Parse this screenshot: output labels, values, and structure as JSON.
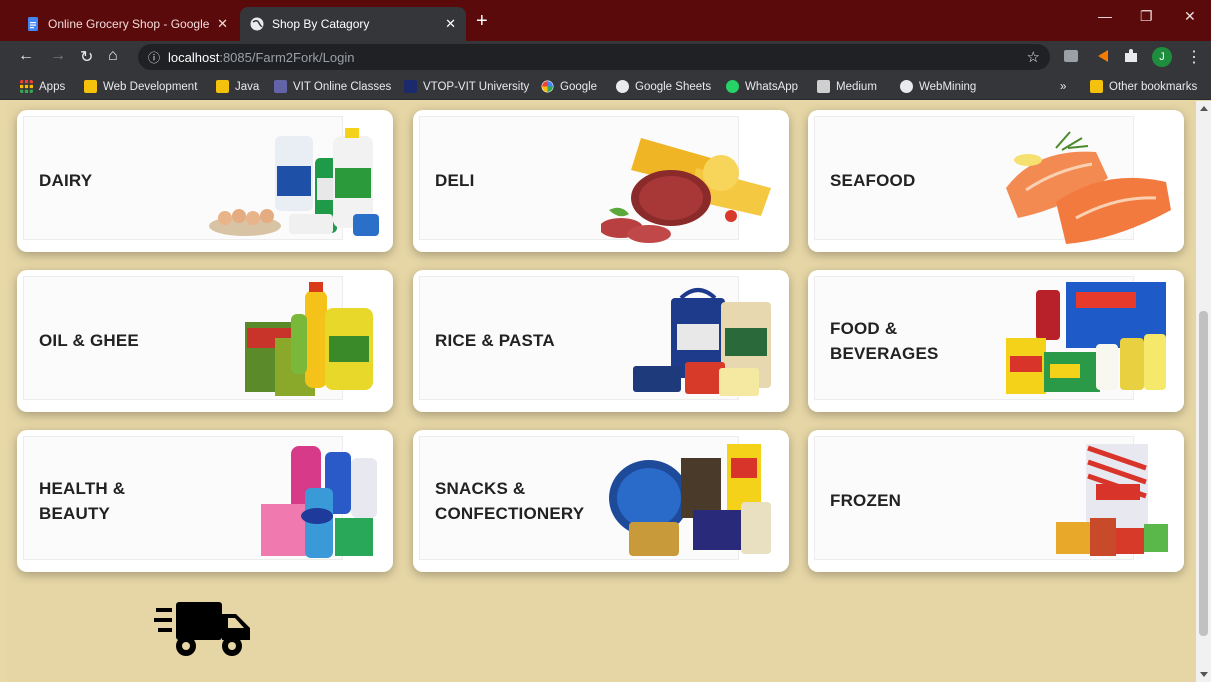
{
  "tabs": [
    {
      "title": "Online Grocery Shop - Google Do",
      "active": false
    },
    {
      "title": "Shop By Catagory",
      "active": true
    }
  ],
  "toolbar": {
    "url_host": "localhost",
    "url_path": ":8085/Farm2Fork/Login",
    "profile_initial": "J"
  },
  "bookmarks": [
    {
      "label": "Apps",
      "icon": "apps-grid-icon"
    },
    {
      "label": "Web Development",
      "icon": "folder-icon"
    },
    {
      "label": "Java",
      "icon": "folder-icon"
    },
    {
      "label": "VIT Online Classes",
      "icon": "teams-icon"
    },
    {
      "label": "VTOP-VIT University",
      "icon": "site-icon"
    },
    {
      "label": "Google",
      "icon": "google-icon"
    },
    {
      "label": "Google Sheets",
      "icon": "globe-icon"
    },
    {
      "label": "WhatsApp",
      "icon": "whatsapp-icon"
    },
    {
      "label": "Medium",
      "icon": "medium-icon"
    },
    {
      "label": "WebMining",
      "icon": "globe-icon"
    }
  ],
  "bookmarks_overflow": "»",
  "other_bookmarks": "Other bookmarks",
  "categories": [
    {
      "label": "DAIRY"
    },
    {
      "label": "DELI"
    },
    {
      "label": "SEAFOOD"
    },
    {
      "label": "OIL & GHEE"
    },
    {
      "label": "RICE & PASTA"
    },
    {
      "label": "FOOD &\nBEVERAGES"
    },
    {
      "label": "HEALTH &\nBEAUTY"
    },
    {
      "label": "SNACKS &\nCONFECTIONERY"
    },
    {
      "label": "FROZEN"
    }
  ],
  "colors": {
    "page_background": "#e6d6a6",
    "titlebar": "#5a0a0a",
    "chrome": "#35363a"
  }
}
